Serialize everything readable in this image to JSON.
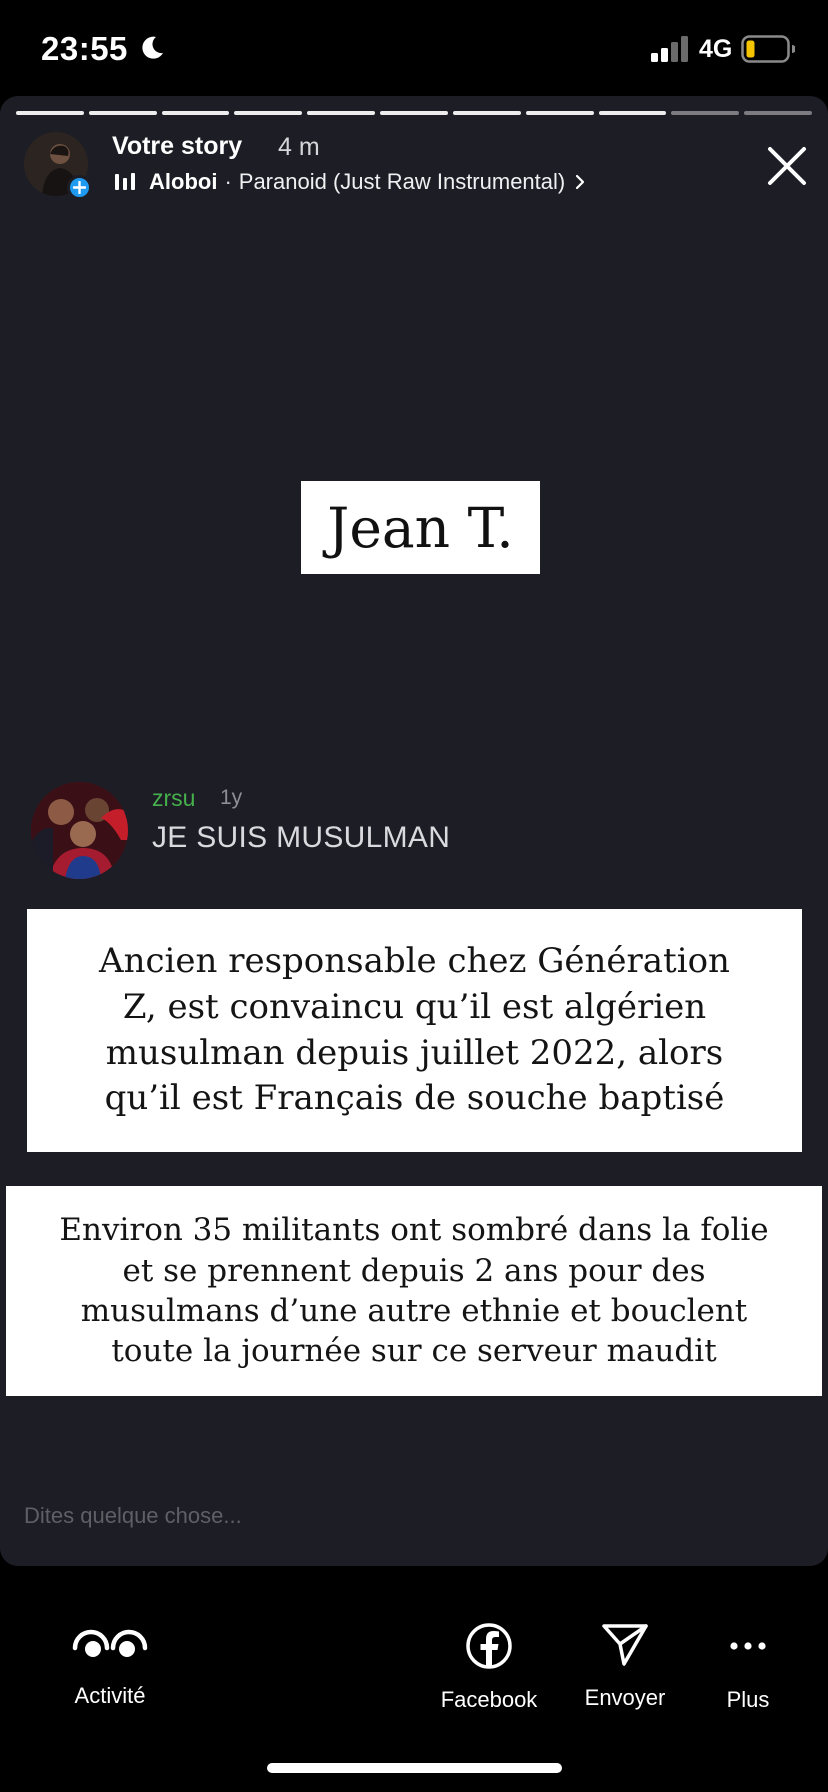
{
  "status_bar": {
    "time": "23:55",
    "network": "4G",
    "battery_color": "#f5c400",
    "icons": [
      "moon-icon",
      "signal-icon",
      "battery-icon"
    ]
  },
  "story": {
    "title": "Votre story",
    "time_ago": "4 m",
    "progress": {
      "segments": 11,
      "completed": 9
    },
    "music": {
      "artist": "Aloboi",
      "separator": "·",
      "track": "Paranoid (Just Raw Instrumental)",
      "chevron": "›"
    },
    "name_box": "Jean T.",
    "comment": {
      "username": "zrsu",
      "age": "1y",
      "text": "JE SUIS MUSULMAN",
      "username_color": "#46b04c"
    },
    "caption_one": [
      "Ancien responsable chez Génération",
      "Z, est convaincu qu’il est algérien",
      "musulman depuis juillet 2022, alors",
      "qu’il est Français de souche baptisé"
    ],
    "caption_two": [
      "Environ 35 militants ont sombré dans la folie",
      "et se prennent depuis 2 ans pour des",
      "musulmans d’une autre ethnie et bouclent",
      "toute la journée sur ce serveur maudit"
    ],
    "reply_placeholder": "Dites quelque chose..."
  },
  "actions": [
    {
      "label": "Activité",
      "icon": "eyes-icon"
    },
    {
      "label": "Facebook",
      "icon": "facebook-icon"
    },
    {
      "label": "Envoyer",
      "icon": "send-icon"
    },
    {
      "label": "Plus",
      "icon": "more-icon"
    }
  ],
  "colors": {
    "story_background": "#1d1d25",
    "badge_blue": "#1e9bf0"
  }
}
